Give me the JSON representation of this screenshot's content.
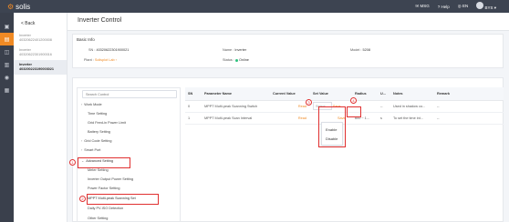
{
  "topbar": {
    "logo": "solis",
    "msg": "MSG",
    "help": "Help",
    "lang": "EN",
    "user": "BYS"
  },
  "sidebar": {
    "back": "< Back",
    "devices": [
      {
        "type": "Inverter",
        "sn": "40320622401200008"
      },
      {
        "type": "Inverter",
        "sn": "40320622301900016"
      },
      {
        "type": "Inverter",
        "sn": "403200223190003021"
      }
    ]
  },
  "page": {
    "title": "Inverter Control"
  },
  "basic_info": {
    "title": "Basic Info",
    "sn_label": "SN :",
    "sn_value": "40320622301900021",
    "name_label": "Name :",
    "name_value": "Inverter",
    "model_label": "Model :",
    "model_value": "5208",
    "plant_label": "Plant :",
    "plant_value": "Solisplot Lab",
    "status_label": "Status :",
    "status_value": "Online"
  },
  "tree": {
    "search_placeholder": "Search Control",
    "nodes": [
      "Work Mode",
      "Time Setting",
      "Grid Feed-in Power Limit",
      "Battery Setting",
      "Grid Code Setting",
      "Smart Port",
      "Advanced Setting",
      "Meter Setting",
      "Inverter Output Power Setting",
      "Power Factor Setting",
      "MPPT Multi-peak Scanning Set",
      "Daily PV-ISO Detection",
      "Other Setting"
    ]
  },
  "table": {
    "headers": [
      "SN",
      "Parameter Name",
      "Current Value",
      "Set Value",
      "Radius",
      "U...",
      "Notes",
      "Remark"
    ],
    "rows": [
      {
        "sn": "0",
        "name": "MPPT Multi-peak Scanning Switch",
        "read": "Read",
        "set": "Select",
        "save": "Save",
        "radius": "--",
        "unit": "--",
        "notes": "Used in shadow co...",
        "remark": "--"
      },
      {
        "sn": "1",
        "name": "MPPT Multi-peak Scan Interval",
        "read": "Read",
        "set": "",
        "save": "Save",
        "radius": "600 ~ 1...",
        "unit": "s",
        "notes": "To set the time int...",
        "remark": "--"
      }
    ]
  },
  "dropdown": {
    "options": [
      "Enable",
      "Disable"
    ]
  },
  "annotations": [
    "1",
    "2",
    "3",
    "4"
  ],
  "colors": {
    "accent": "#f08a24",
    "topbar": "#3d4451",
    "annotation": "#e03030"
  }
}
